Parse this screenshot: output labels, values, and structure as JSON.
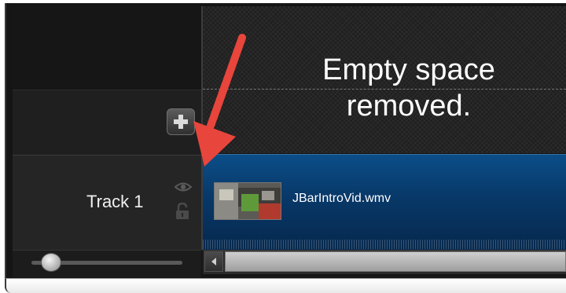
{
  "timeline": {
    "caption_line1": "Empty space",
    "caption_line2": "removed.",
    "track": {
      "label": "Track 1",
      "clip_name": "JBarIntroVid.wmv"
    },
    "add_track_icon": "plus-icon",
    "visibility_icon": "eye-icon",
    "lock_icon": "lock-icon",
    "zoom_level_fraction": 0.1
  },
  "colors": {
    "annotation_arrow": "#e8453c",
    "track_lane": "#0b4e88"
  }
}
